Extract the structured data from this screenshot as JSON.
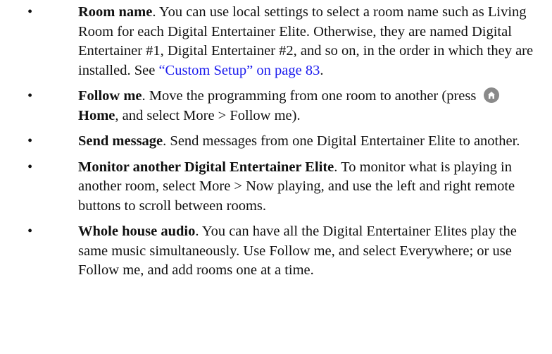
{
  "items": [
    {
      "bullet": "•",
      "term": "Room name",
      "text": ". You can use local settings to select a room name such as Living Room for each Digital Entertainer Elite. Otherwise, they are named Digital Entertainer #1, Digital Entertainer #2, and so on, in the order in which they are installed. See ",
      "link": "“Custom Setup” on page 83",
      "after": "."
    },
    {
      "bullet": "•",
      "term": "Follow me",
      "text_before": ". Move the programming from one room to another (press ",
      "icon": "home-icon",
      "home_label": "Home",
      "text_after": ", and select More > Follow me)."
    },
    {
      "bullet": "•",
      "term": "Send message",
      "text": ". Send messages from one Digital Entertainer Elite to another."
    },
    {
      "bullet": "•",
      "term": "Monitor another Digital Entertainer Elite",
      "text": ". To monitor what is playing in another room, select More > Now playing, and use the left and right remote buttons to scroll between rooms."
    },
    {
      "bullet": "•",
      "term": "Whole house audio",
      "text": ". You can have all the Digital Entertainer Elites play the same music simultaneously. Use Follow me, and select Everywhere; or use Follow me, and add rooms one at a time."
    }
  ],
  "colors": {
    "link": "#1a1aee",
    "text": "#111111",
    "icon_background": "#8a8a8a"
  }
}
